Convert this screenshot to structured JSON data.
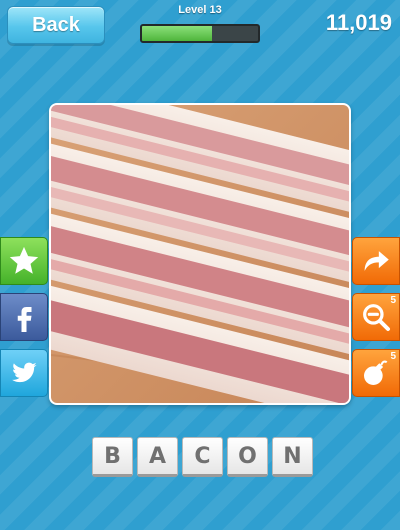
{
  "header": {
    "back_label": "Back",
    "level_label": "Level 13",
    "progress": 0.6,
    "score": "11,019"
  },
  "puzzle": {
    "image_subject": "bacon strips"
  },
  "left_actions": [
    {
      "id": "rate",
      "icon": "star-icon"
    },
    {
      "id": "facebook",
      "icon": "facebook-icon"
    },
    {
      "id": "twitter",
      "icon": "twitter-icon"
    }
  ],
  "right_actions": [
    {
      "id": "skip",
      "icon": "skip-arrow-icon"
    },
    {
      "id": "reveal",
      "icon": "magnifier-minus-icon",
      "count": "5"
    },
    {
      "id": "bomb",
      "icon": "bomb-icon",
      "count": "5"
    }
  ],
  "answer": {
    "letters": [
      "B",
      "A",
      "C",
      "O",
      "N"
    ]
  },
  "colors": {
    "background": "#2f9fd0",
    "progress_fill": "#4fb53c",
    "orange_button": "#f16a06",
    "green_button": "#45b22a"
  }
}
